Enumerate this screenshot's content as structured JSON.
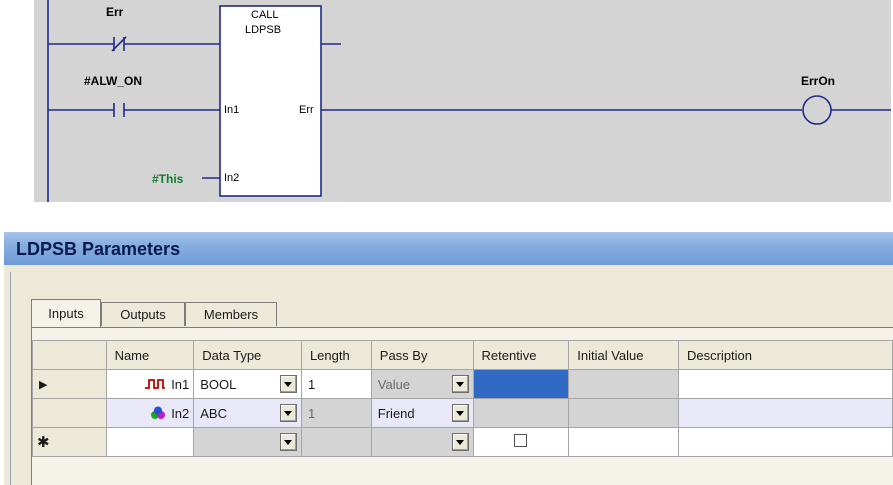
{
  "ladder": {
    "contact1": {
      "label": "Err"
    },
    "contact2": {
      "label": "#ALW_ON"
    },
    "block": {
      "line1": "CALL",
      "line2": "LDPSB",
      "in1": "In1",
      "in2": "In2",
      "out": "Err"
    },
    "coil": {
      "label": "ErrOn"
    },
    "in2_operand": "#This"
  },
  "dialog": {
    "title": "LDPSB Parameters",
    "tabs": [
      {
        "label": "Inputs",
        "active": true
      },
      {
        "label": "Outputs",
        "active": false
      },
      {
        "label": "Members",
        "active": false
      }
    ],
    "columns": [
      "Name",
      "Data Type",
      "Length",
      "Pass By",
      "Retentive",
      "Initial Value",
      "Description"
    ],
    "rows": [
      {
        "marker": "▶",
        "icon": "pulse-icon",
        "name": "In1",
        "data_type": "BOOL",
        "length": "1",
        "pass_by": "Value",
        "retentive": "",
        "initial_value": "",
        "description": ""
      },
      {
        "marker": "",
        "icon": "structure-icon",
        "name": "In2",
        "data_type": "ABC",
        "length": "1",
        "pass_by": "Friend",
        "retentive": "",
        "initial_value": "",
        "description": ""
      },
      {
        "marker": "✱",
        "icon": "",
        "name": "",
        "data_type": "",
        "length": "",
        "pass_by": "",
        "retentive": "",
        "initial_value": "",
        "description": ""
      }
    ],
    "colors": {
      "selection": "#316ac5",
      "titlebar": "#86aee0",
      "rung": "#1a2a8c"
    }
  }
}
